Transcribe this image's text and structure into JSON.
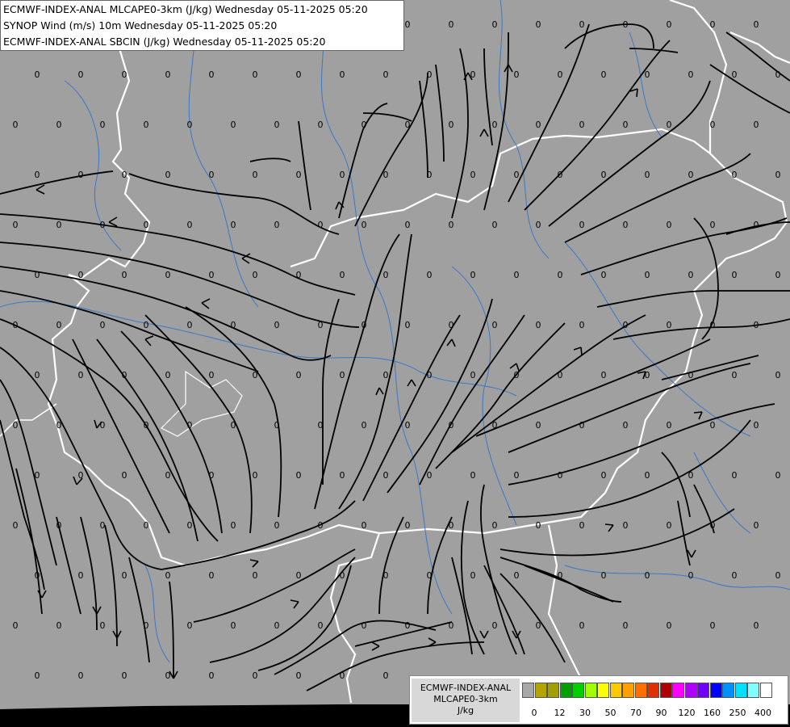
{
  "header": {
    "line1": "ECMWF-INDEX-ANAL MLCAPE0-3km (J/kg) Wednesday 05-11-2025 05:20",
    "line2": "SYNOP Wind (m/s) 10m Wednesday 05-11-2025 05:20",
    "line3": "ECMWF-INDEX-ANAL SBCIN (J/kg) Wednesday 05-11-2025 05:20"
  },
  "legend": {
    "title": "ECMWF-INDEX-ANAL",
    "subtitle": "MLCAPE0-3km",
    "unit": "J/kg",
    "colors": [
      "#a8a8a8",
      "#b4a400",
      "#a0a000",
      "#00a000",
      "#00d000",
      "#a0ff00",
      "#ffff00",
      "#ffc800",
      "#ffa000",
      "#ff7000",
      "#e03000",
      "#b00000",
      "#ff00ff",
      "#b000ff",
      "#7000ff",
      "#0000ff",
      "#0090ff",
      "#00e0ff",
      "#80ffff",
      "#ffffff"
    ],
    "ticks": [
      "0",
      "12",
      "30",
      "50",
      "70",
      "90",
      "120",
      "160",
      "250",
      "400"
    ]
  },
  "map": {
    "value_label": "0",
    "background": "#a0a0a0",
    "border_color": "#ffffff",
    "river_color": "#3a78c8",
    "streamline_color": "#000000"
  }
}
